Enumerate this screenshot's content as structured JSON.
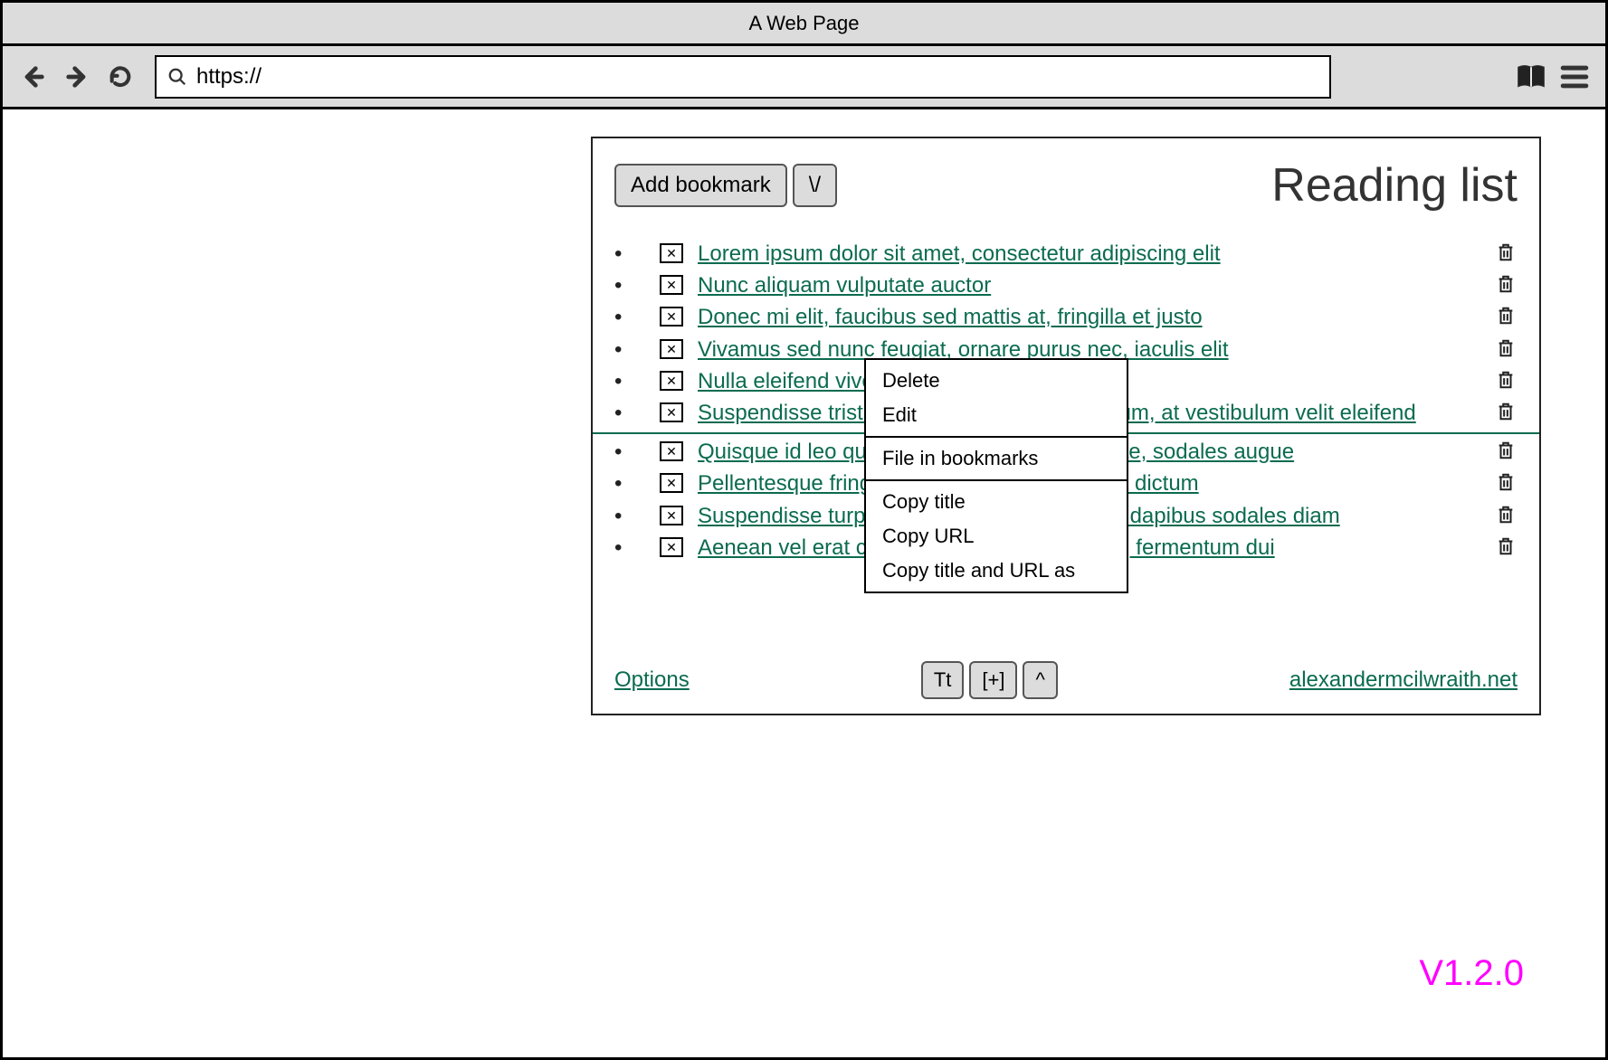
{
  "window": {
    "title": "A Web Page"
  },
  "urlbar": {
    "value": "https://"
  },
  "panel": {
    "title": "Reading list",
    "add_bookmark_label": "Add bookmark",
    "collapse_label": "\\/",
    "options_label": "Options",
    "site_label": "alexandermcilwraith.net",
    "footer_buttons": {
      "tt": "Tt",
      "expand": "[+]",
      "caret": "^"
    }
  },
  "reading_list": {
    "group_a": [
      "Lorem ipsum dolor sit amet, consectetur adipiscing elit",
      "Nunc aliquam vulputate auctor",
      "Donec mi elit, faucibus sed mattis at, fringilla et justo",
      "Vivamus sed nunc feugiat, ornare purus nec, iaculis elit",
      "Nulla eleifend viverra auctor",
      "Suspendisse tristique tellus vitae condimentum, at vestibulum velit eleifend"
    ],
    "group_b": [
      "Quisque id leo quis sem pulvinar tempus vitae, sodales augue",
      "Pellentesque fringilla egestas augue sit amet dictum",
      "Suspendisse turpis mi, placerat sed semper, dapibus sodales diam",
      "Aenean vel erat consectetur, auctor purus ut, fermentum dui"
    ]
  },
  "context_menu": {
    "group1": [
      "Delete",
      "Edit"
    ],
    "group2": [
      "File in bookmarks"
    ],
    "group3": [
      "Copy title",
      "Copy URL",
      "Copy title and URL as"
    ]
  },
  "version": "V1.2.0"
}
